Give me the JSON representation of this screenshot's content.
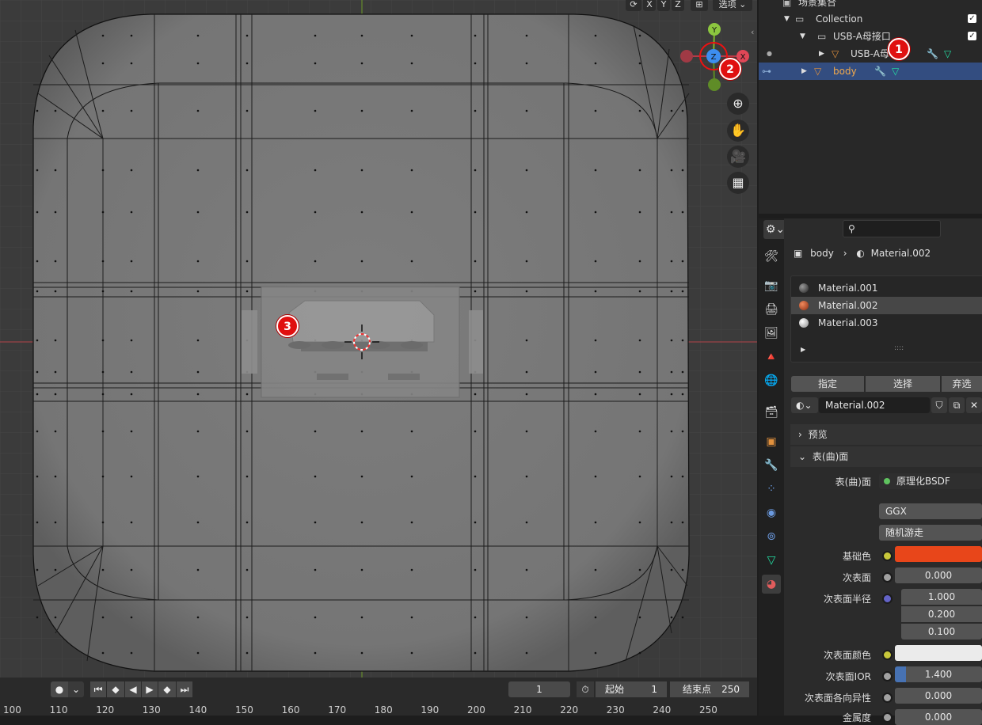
{
  "viewport": {
    "header": {
      "axis_x": "X",
      "axis_y": "Y",
      "axis_z": "Z",
      "options_label": "选项"
    },
    "gizmo": {
      "y": "Y",
      "z": "Z",
      "x": "X"
    },
    "nav_icons": [
      "zoom-icon",
      "hand-icon",
      "camera-icon",
      "grid-icon"
    ],
    "annotations": [
      "1",
      "2",
      "3"
    ]
  },
  "outliner": {
    "scene_collection": "场景集合",
    "rows": [
      {
        "label": "Collection",
        "checked": true
      },
      {
        "label": "USB-A母接口",
        "checked": true
      },
      {
        "label": "USB-A母",
        "checked": false
      },
      {
        "label": "body",
        "selected": true
      }
    ]
  },
  "properties": {
    "breadcrumb_object": "body",
    "breadcrumb_material": "Material.002",
    "materials": [
      "Material.001",
      "Material.002",
      "Material.003"
    ],
    "list_handle": "::::",
    "slot_buttons": [
      "指定",
      "选择",
      "弃选"
    ],
    "active_material": "Material.002",
    "preview_label": "预览",
    "surface_label": "表(曲)面",
    "surface_field_label": "表(曲)面",
    "surface_shader": "原理化BSDF",
    "distribution": "GGX",
    "subsurface_method": "随机游走",
    "base_color_label": "基础色",
    "base_color": "#e8461a",
    "subsurface_label": "次表面",
    "subsurface_value": "0.000",
    "subsurface_radius_label": "次表面半径",
    "subsurface_radius": [
      "1.000",
      "0.200",
      "0.100"
    ],
    "subsurface_color_label": "次表面颜色",
    "subsurface_ior_label": "次表面IOR",
    "subsurface_ior": "1.400",
    "subsurface_aniso_label": "次表面各向异性",
    "subsurface_aniso": "0.000",
    "metallic_label": "金属度",
    "metallic": "0.000"
  },
  "timeline": {
    "current_frame": "1",
    "start_label": "起始",
    "start_value": "1",
    "end_label": "结束点",
    "end_value": "250",
    "ruler": [
      "100",
      "110",
      "120",
      "130",
      "140",
      "150",
      "160",
      "170",
      "180",
      "190",
      "200",
      "210",
      "220",
      "230",
      "240",
      "250"
    ]
  }
}
